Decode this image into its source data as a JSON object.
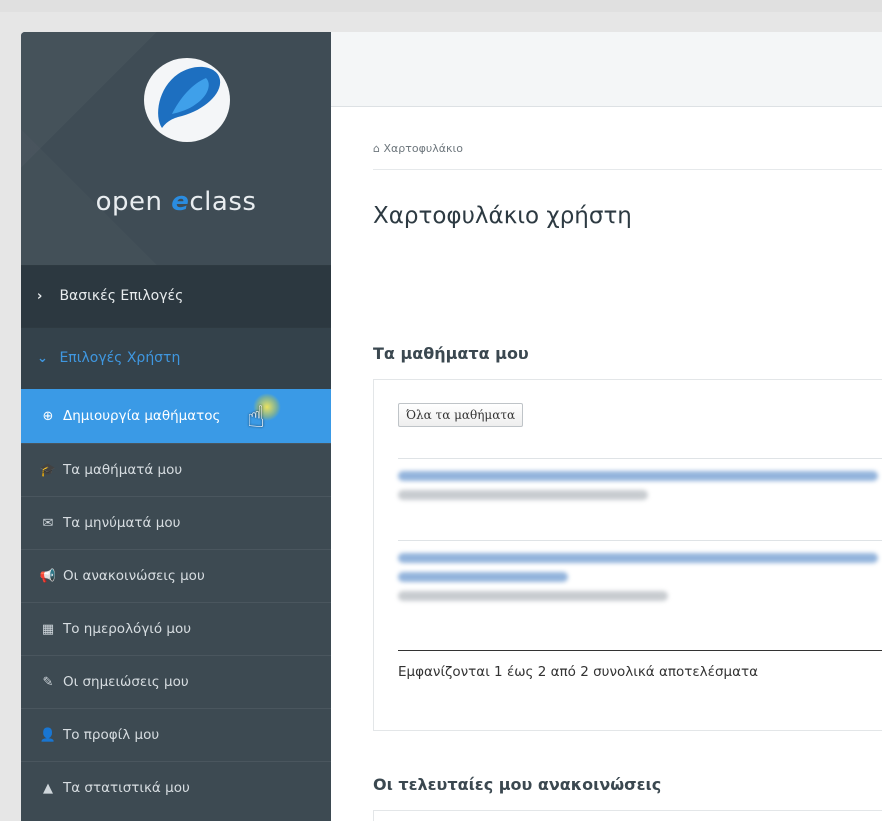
{
  "logo": {
    "word1": "open ",
    "word2": "e",
    "word3": "class"
  },
  "sidebar": {
    "categories": [
      {
        "label": "Βασικές Επιλογές",
        "chevron": "›"
      },
      {
        "label": "Επιλογές Χρήστη",
        "chevron": "⌄"
      }
    ],
    "items": [
      {
        "label": "Δημιουργία μαθήματος",
        "icon": "plus-circle-icon",
        "glyph": "⊕"
      },
      {
        "label": "Τα μαθήματά μου",
        "icon": "graduation-cap-icon",
        "glyph": "🎓"
      },
      {
        "label": "Τα μηνύματά μου",
        "icon": "envelope-icon",
        "glyph": "✉"
      },
      {
        "label": "Οι ανακοινώσεις μου",
        "icon": "bullhorn-icon",
        "glyph": "📢"
      },
      {
        "label": "Το ημερολόγιό μου",
        "icon": "calendar-icon",
        "glyph": "▦"
      },
      {
        "label": "Οι σημειώσεις μου",
        "icon": "edit-icon",
        "glyph": "✎"
      },
      {
        "label": "Το προφίλ μου",
        "icon": "user-icon",
        "glyph": "👤"
      },
      {
        "label": "Τα στατιστικά μου",
        "icon": "area-chart-icon",
        "glyph": "▲"
      }
    ]
  },
  "breadcrumb": {
    "icon": "home-icon",
    "glyph": "⌂",
    "label": "Χαρτοφυλάκιο"
  },
  "page_title": "Χαρτοφυλάκιο χρήστη",
  "courses": {
    "title": "Τα μαθήματα μου",
    "all_button": "Όλα τα μαθήματα",
    "results_text": "Εμφανίζονται 1 έως 2 από 2 συνολικά αποτελέσματα"
  },
  "announcements": {
    "title": "Οι τελευταίες μου ανακοινώσεις"
  },
  "colors": {
    "sidebar_bg": "#3d4a52",
    "active_item": "#3a9ae6",
    "accent_blue": "#2a8ce0"
  }
}
